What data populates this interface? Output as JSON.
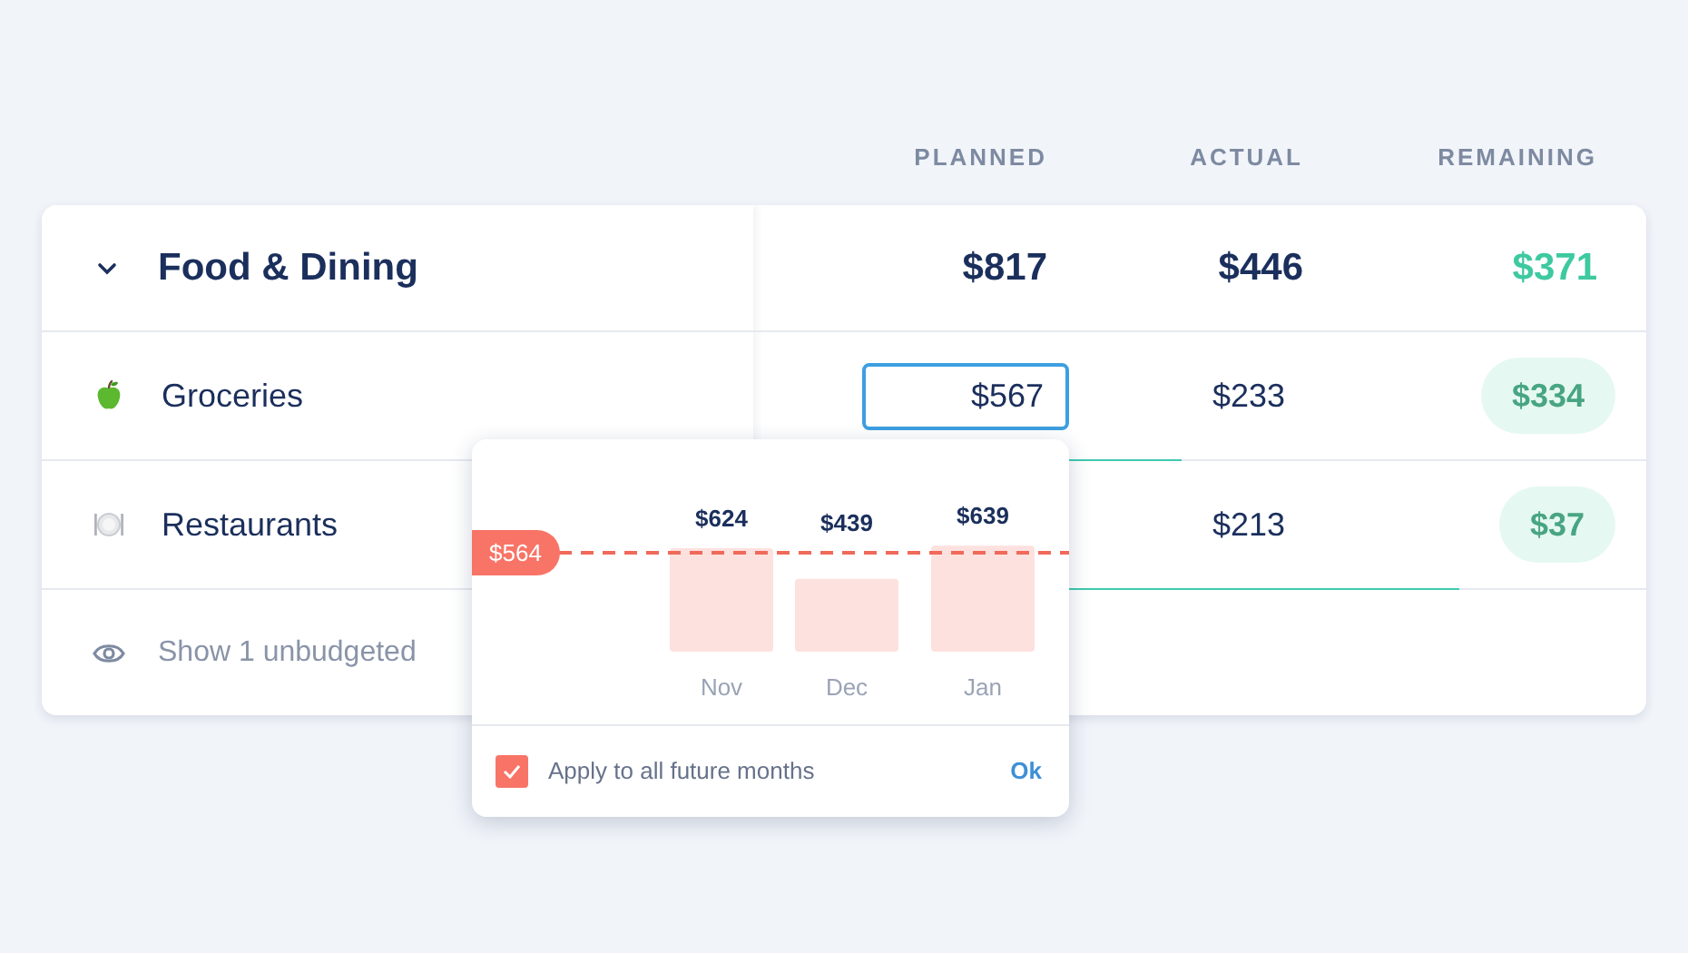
{
  "columns": [
    "PLANNED",
    "ACTUAL",
    "REMAINING"
  ],
  "group": {
    "name": "Food & Dining",
    "expanded": true,
    "planned": "$817",
    "actual": "$446",
    "remaining": "$371"
  },
  "rows": [
    {
      "kind": "apple",
      "name": "Groceries",
      "planned": "$567",
      "editing": true,
      "actual": "$233",
      "remaining": "$334",
      "level": 0.48
    },
    {
      "kind": "plate",
      "name": "Restaurants",
      "editing": false,
      "actual": "$213",
      "remaining": "$37",
      "level": 0.79
    }
  ],
  "unbudgeted": "Show 1 unbudgeted",
  "popover": {
    "chart_data": {
      "type": "bar",
      "categories": [
        "Nov",
        "Dec",
        "Jan"
      ],
      "values": [
        624,
        439,
        639
      ],
      "value_labels": [
        "$624",
        "$439",
        "$639"
      ]
    },
    "average": "$564",
    "apply": {
      "label": "Apply to all future months",
      "checked": true
    },
    "ok": "Ok"
  }
}
